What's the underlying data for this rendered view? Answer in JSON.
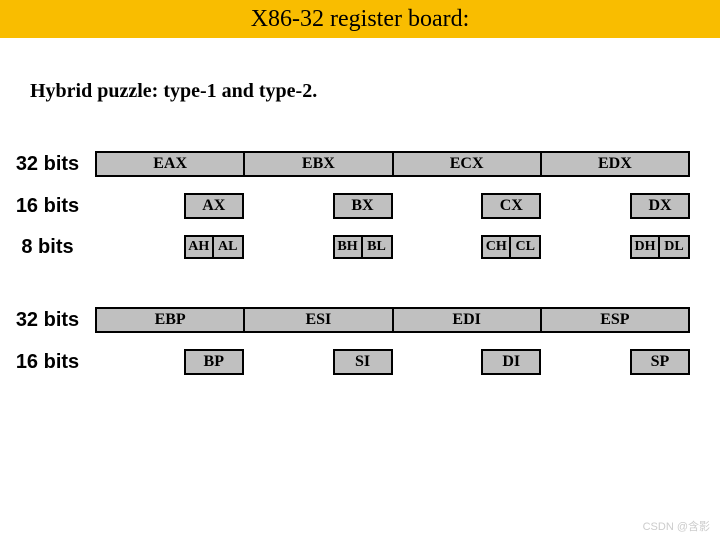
{
  "title": "X86-32 register board:",
  "subtitle": "Hybrid puzzle: type-1 and type-2.",
  "labels": {
    "bits32": "32 bits",
    "bits16": "16 bits",
    "bits8": "8 bits"
  },
  "group1": {
    "row32": [
      "EAX",
      "EBX",
      "ECX",
      "EDX"
    ],
    "row16": [
      "AX",
      "BX",
      "CX",
      "DX"
    ],
    "row8": [
      [
        "AH",
        "AL"
      ],
      [
        "BH",
        "BL"
      ],
      [
        "CH",
        "CL"
      ],
      [
        "DH",
        "DL"
      ]
    ]
  },
  "group2": {
    "row32": [
      "EBP",
      "ESI",
      "EDI",
      "ESP"
    ],
    "row16": [
      "BP",
      "SI",
      "DI",
      "SP"
    ]
  },
  "watermark": "CSDN @含影"
}
